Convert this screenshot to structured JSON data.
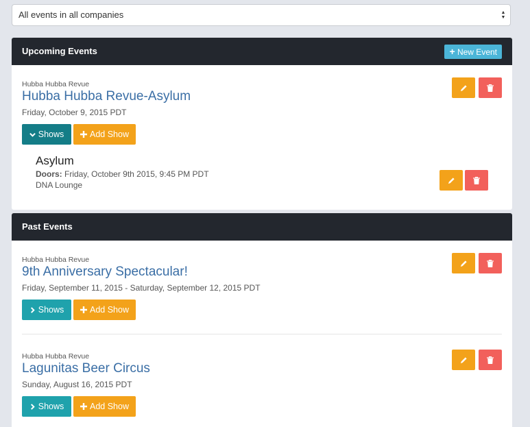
{
  "filter": {
    "selected": "All events in all companies"
  },
  "upcoming": {
    "header": "Upcoming Events",
    "new_event_label": "New Event",
    "events": [
      {
        "company": "Hubba Hubba Revue",
        "title": "Hubba Hubba Revue-Asylum",
        "date": "Friday, October 9, 2015 PDT",
        "shows_label": "Shows",
        "add_show_label": "Add Show",
        "shows_expanded": true,
        "shows": [
          {
            "title": "Asylum",
            "doors_label": "Doors:",
            "doors_time": "Friday, October 9th 2015, 9:45 PM PDT",
            "venue": "DNA Lounge"
          }
        ]
      }
    ]
  },
  "past": {
    "header": "Past Events",
    "events": [
      {
        "company": "Hubba Hubba Revue",
        "title": "9th Anniversary Spectacular!",
        "date": "Friday, September 11, 2015 - Saturday, September 12, 2015 PDT",
        "shows_label": "Shows",
        "add_show_label": "Add Show"
      },
      {
        "company": "Hubba Hubba Revue",
        "title": "Lagunitas Beer Circus",
        "date": "Sunday, August 16, 2015 PDT",
        "shows_label": "Shows",
        "add_show_label": "Add Show"
      }
    ]
  },
  "colors": {
    "header_bg": "#23272e",
    "link_blue": "#3a6ea5",
    "teal": "#1fa2ac",
    "teal_dark": "#147d87",
    "orange": "#f3a21a",
    "red": "#f2605b",
    "info": "#4bb5d8"
  },
  "icons": {
    "edit": "pencil-icon",
    "delete": "trash-icon",
    "expand": "chevron-down-icon",
    "collapse": "chevron-right-icon",
    "add": "plus-icon"
  }
}
